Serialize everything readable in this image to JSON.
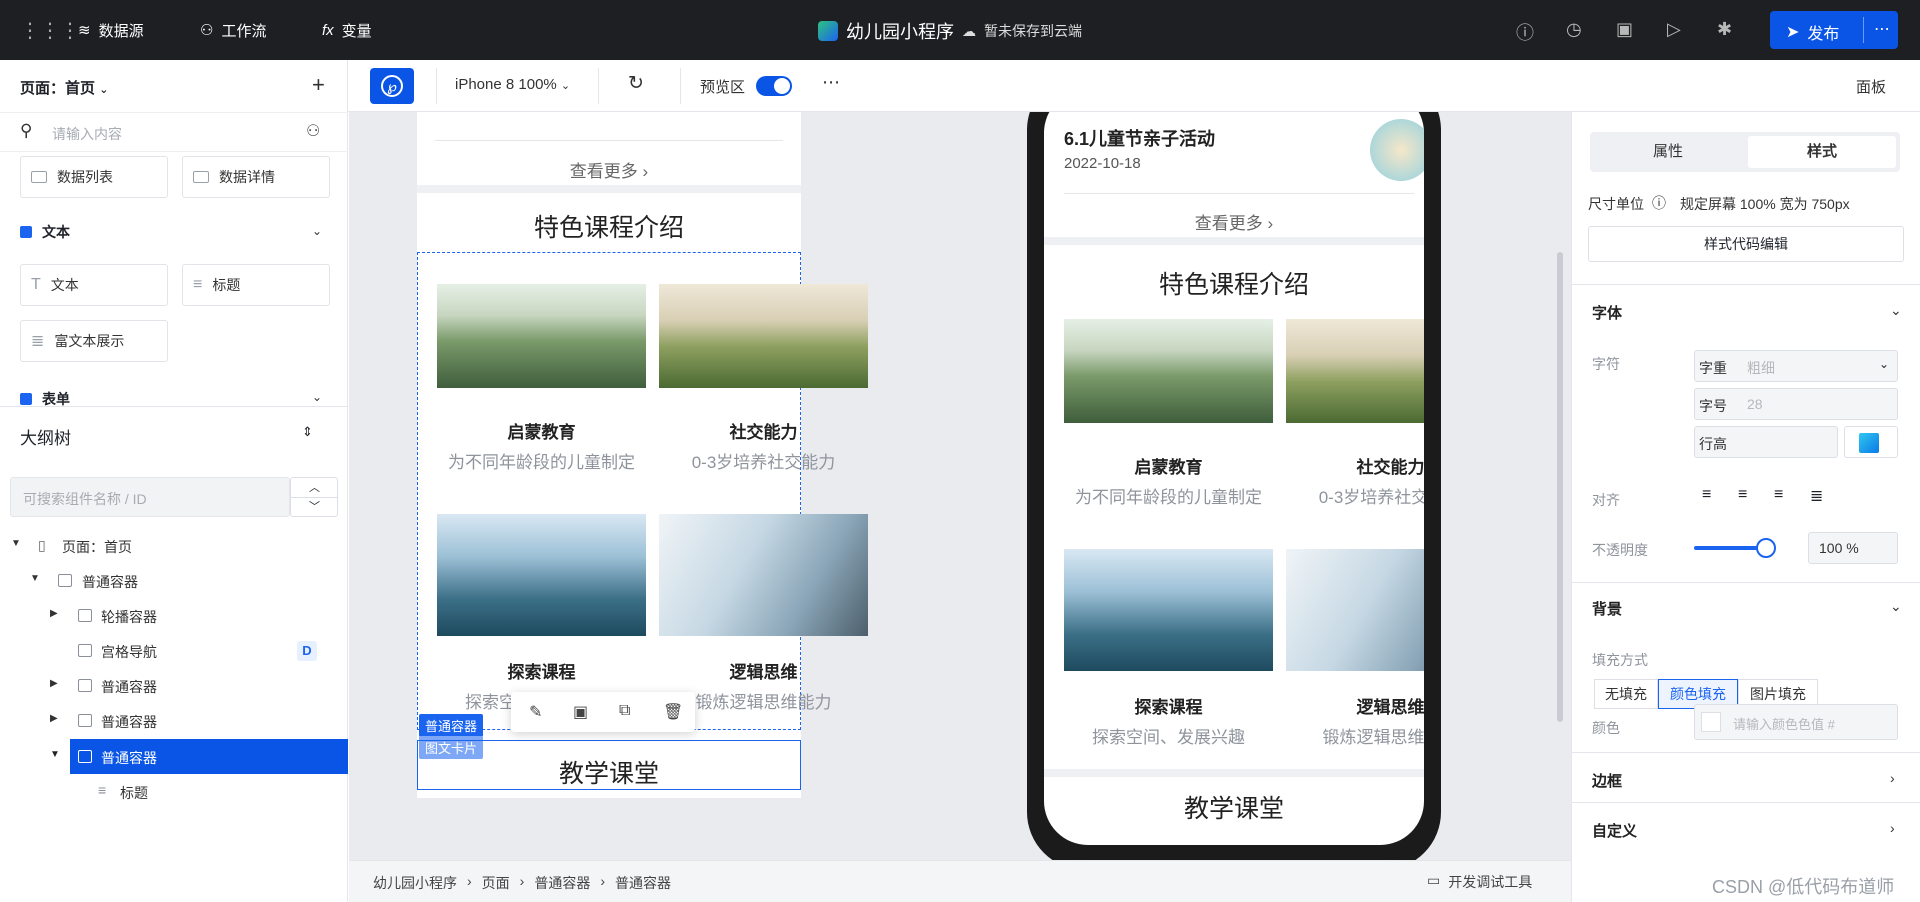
{
  "topbar": {
    "datasource": "数据源",
    "workflow": "工作流",
    "variables": "变量",
    "app_name": "幼儿园小程序",
    "save_status": "暂未保存到云端",
    "publish": "发布"
  },
  "left": {
    "page_selector": "页面：首页",
    "search_placeholder": "请输入内容",
    "components": [
      "数据列表",
      "数据详情"
    ],
    "text_section": "文本",
    "text_components": [
      "文本",
      "标题",
      "富文本展示"
    ],
    "form_section": "表单",
    "outline_title": "大纲树",
    "outline_search_placeholder": "可搜索组件名称 / ID",
    "tree": [
      "页面：首页",
      "普通容器",
      "轮播容器",
      "宫格导航",
      "普通容器",
      "普通容器",
      "普通容器",
      "标题"
    ],
    "badge": "D"
  },
  "toolbar": {
    "device": "iPhone 8 100%",
    "preview": "预览区",
    "panel": "面板"
  },
  "editor": {
    "more": "查看更多",
    "section_title": "特色课程介绍",
    "cards": [
      {
        "title": "启蒙教育",
        "sub": "为不同年龄段的儿童制定"
      },
      {
        "title": "社交能力",
        "sub": "0-3岁培养社交能力"
      },
      {
        "title": "探索课程",
        "sub": "探索空间、发展兴趣"
      },
      {
        "title": "逻辑思维",
        "sub": "锻炼逻辑思维能力"
      }
    ],
    "tag1": "普通容器",
    "tag2": "图文卡片",
    "teaching": "教学课堂"
  },
  "phone": {
    "news_title": "6.1儿童节亲子活动",
    "news_date": "2022-10-18",
    "more": "查看更多",
    "section_title": "特色课程介绍",
    "teaching": "教学课堂"
  },
  "status": {
    "breadcrumbs": [
      "幼儿园小程序",
      "页面",
      "普通容器",
      "普通容器"
    ],
    "devtools": "开发调试工具"
  },
  "right": {
    "tab_props": "属性",
    "tab_style": "样式",
    "unit_label": "尺寸单位",
    "unit_value": "规定屏幕 100% 宽为 750px",
    "code_btn": "样式代码编辑",
    "font_section": "字体",
    "char_label": "字符",
    "weight_label": "字重",
    "weight_value": "粗细",
    "size_label": "字号",
    "size_value": "28",
    "line_height_label": "行高",
    "align_label": "对齐",
    "opacity_label": "不透明度",
    "opacity_value": "100 %",
    "opacity": 1.0,
    "bg_section": "背景",
    "fill_label": "填充方式",
    "fill_options": [
      "无填充",
      "颜色填充",
      "图片填充"
    ],
    "color_label": "颜色",
    "color_placeholder": "请输入颜色色值 #",
    "border_section": "边框",
    "custom_section": "自定义"
  },
  "watermark": "CSDN @低代码布道师",
  "colors": {
    "accent": "#0a55e6",
    "topbar": "#1e1f22"
  }
}
